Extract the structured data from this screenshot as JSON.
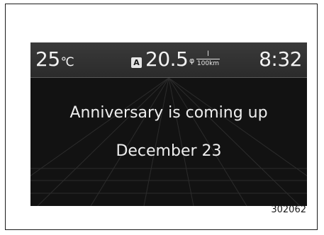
{
  "status_bar": {
    "temperature": "25",
    "temperature_unit": "℃",
    "fuel_mode_badge": "A",
    "fuel_economy": "20.5",
    "fuel_unit_prefix": "φ",
    "fuel_unit_numerator": "l",
    "fuel_unit_denominator": "100km",
    "clock": "8:32"
  },
  "message": {
    "line1": "Anniversary is coming up",
    "line2": "December 23"
  },
  "figure_id": "302062"
}
